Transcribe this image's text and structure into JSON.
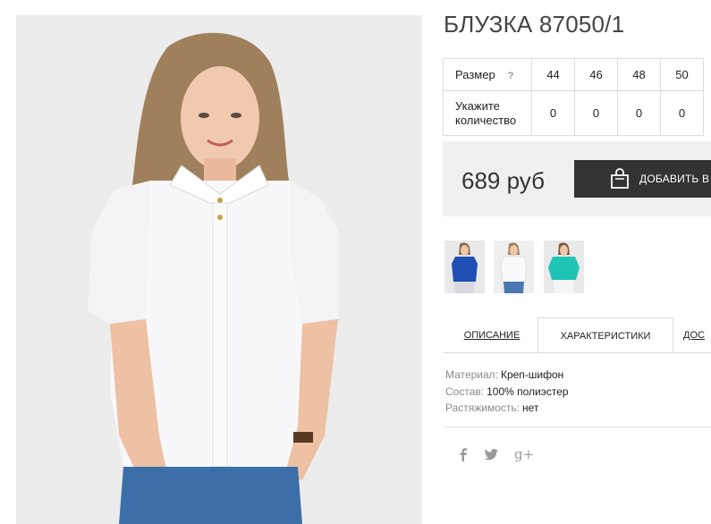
{
  "product": {
    "title": "БЛУЗКА 87050/1"
  },
  "size_table": {
    "size_label": "Размер",
    "help_mark": "?",
    "sizes": [
      "44",
      "46",
      "48",
      "50"
    ],
    "quantity_label_line1": "Укажите",
    "quantity_label_line2": "количество",
    "quantities": [
      "0",
      "0",
      "0",
      "0"
    ]
  },
  "buy": {
    "price": "689 руб",
    "cart_label": "ДОБАВИТЬ В З",
    "cart_icon": "shopping-bag-icon"
  },
  "thumbnails": [
    {
      "color": "blue",
      "swatch": "#1f4fb4"
    },
    {
      "color": "white",
      "swatch": "#f4f4f4"
    },
    {
      "color": "turquoise",
      "swatch": "#1fc4b4"
    }
  ],
  "tabs": [
    {
      "label": "ОПИСАНИЕ",
      "active": false
    },
    {
      "label": "ХАРАКТЕРИСТИКИ",
      "active": true
    },
    {
      "label": "ДОС",
      "active": false
    }
  ],
  "characteristics": [
    {
      "key": "Материал:",
      "value": "Креп-шифон"
    },
    {
      "key": "Состав:",
      "value": "100% полиэстер"
    },
    {
      "key": "Растяжимость:",
      "value": "нет"
    }
  ],
  "social": [
    {
      "icon": "facebook-icon",
      "glyph": "f"
    },
    {
      "icon": "twitter-icon",
      "glyph": "twitter"
    },
    {
      "icon": "google-plus-icon",
      "glyph": "g+"
    }
  ],
  "colors": {
    "accent_dark": "#333333",
    "buybox_bg": "#f0f0f0",
    "border": "#dcdcdc"
  }
}
